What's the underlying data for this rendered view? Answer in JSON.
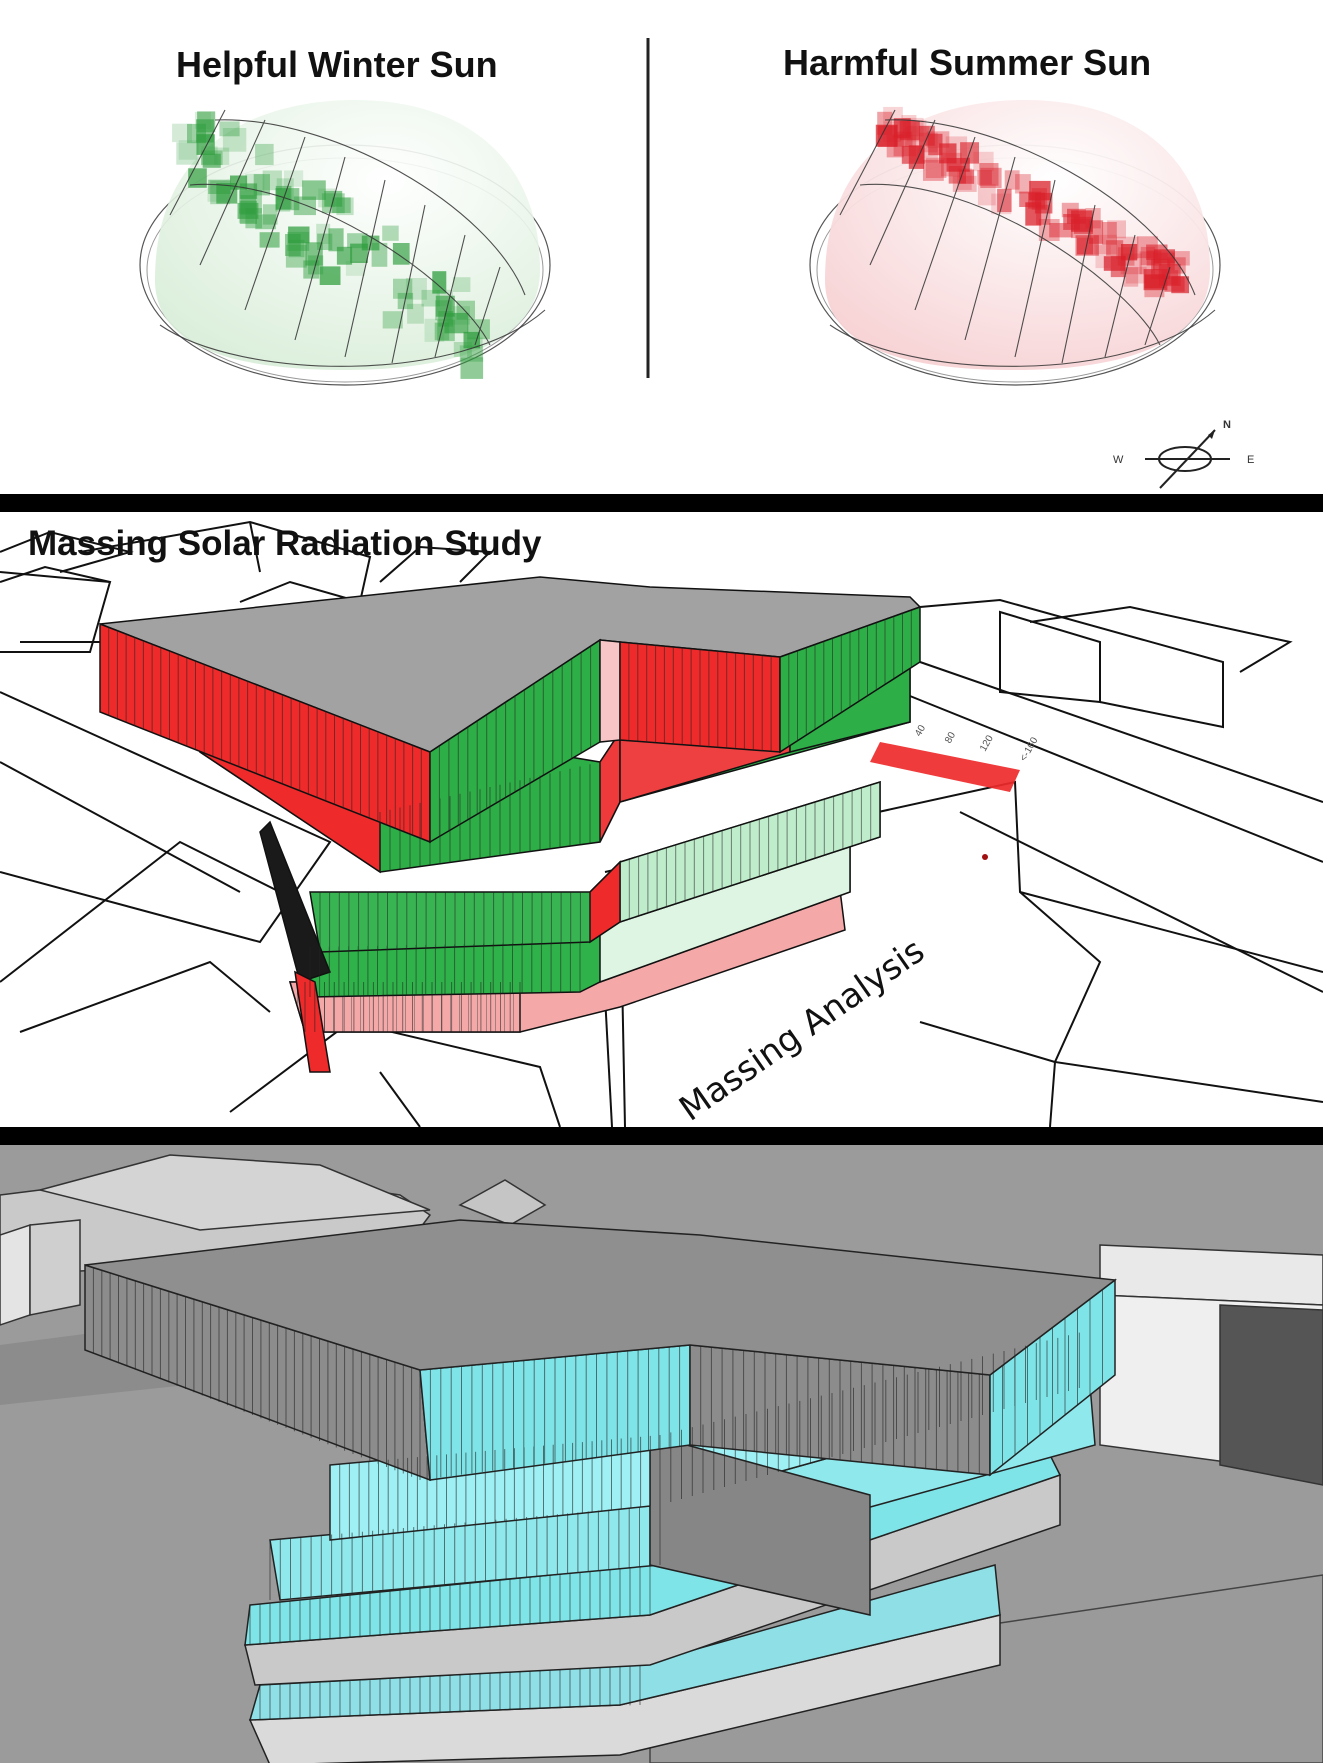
{
  "sun_study": {
    "winter_title": "Helpful Winter Sun",
    "summer_title": "Harmful Summer Sun",
    "winter_color": "#2e9d3d",
    "summer_color": "#d9202a",
    "compass": {
      "north": "N",
      "west": "W",
      "east": "E"
    }
  },
  "massing_study": {
    "title": "Massing Solar Radiation Study",
    "analysis_label": "Massing Analysis",
    "scale_ticks": [
      "40",
      "80",
      "120",
      "<-160"
    ],
    "hot_color": "#ee2a2a",
    "cool_color": "#1fa83a"
  },
  "render": {
    "glass_color": "#7fe4e8",
    "roof_color": "#8f8f8f"
  }
}
